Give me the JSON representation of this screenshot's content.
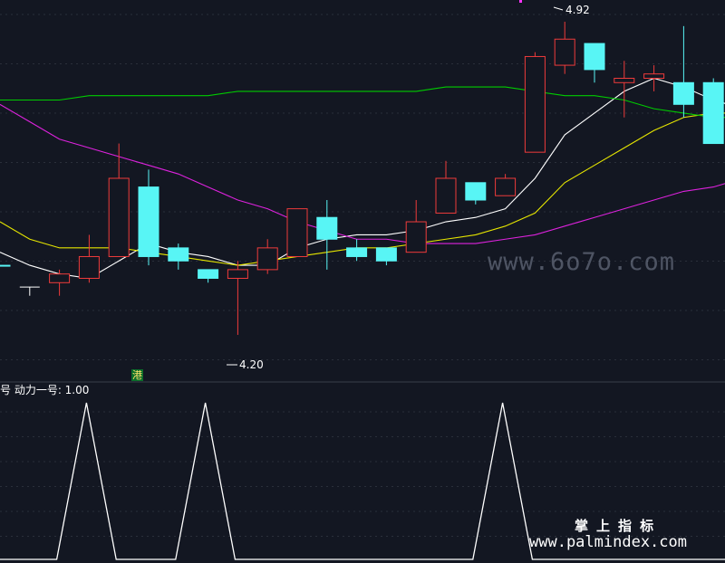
{
  "chart_data": {
    "type": "candlestick",
    "title": "",
    "indicator_label": "号 动力一号: 1.00",
    "annotations": {
      "high_label": "4.92",
      "low_label": "4.20",
      "tag": "港"
    },
    "watermarks": {
      "top": "www.6o7o.com",
      "bottom_cn": "掌 上 指 标",
      "bottom_url": "www.palmindex.com"
    },
    "ylim": [
      4.1,
      4.97
    ],
    "candles": [
      {
        "o": 4.36,
        "h": 4.36,
        "l": 4.36,
        "c": 4.36,
        "dir": "down",
        "partial": true
      },
      {
        "o": 4.31,
        "h": 4.31,
        "l": 4.29,
        "c": 4.31,
        "dir": "doji"
      },
      {
        "o": 4.32,
        "h": 4.35,
        "l": 4.29,
        "c": 4.34,
        "dir": "up"
      },
      {
        "o": 4.33,
        "h": 4.43,
        "l": 4.32,
        "c": 4.38,
        "dir": "up"
      },
      {
        "o": 4.38,
        "h": 4.64,
        "l": 4.38,
        "c": 4.56,
        "dir": "up"
      },
      {
        "o": 4.54,
        "h": 4.58,
        "l": 4.36,
        "c": 4.38,
        "dir": "down"
      },
      {
        "o": 4.4,
        "h": 4.41,
        "l": 4.35,
        "c": 4.37,
        "dir": "down"
      },
      {
        "o": 4.35,
        "h": 4.35,
        "l": 4.32,
        "c": 4.33,
        "dir": "down"
      },
      {
        "o": 4.33,
        "h": 4.37,
        "l": 4.2,
        "c": 4.35,
        "dir": "up"
      },
      {
        "o": 4.35,
        "h": 4.42,
        "l": 4.34,
        "c": 4.4,
        "dir": "up"
      },
      {
        "o": 4.38,
        "h": 4.49,
        "l": 4.38,
        "c": 4.49,
        "dir": "up"
      },
      {
        "o": 4.47,
        "h": 4.51,
        "l": 4.35,
        "c": 4.42,
        "dir": "down"
      },
      {
        "o": 4.4,
        "h": 4.42,
        "l": 4.37,
        "c": 4.38,
        "dir": "down"
      },
      {
        "o": 4.4,
        "h": 4.4,
        "l": 4.36,
        "c": 4.37,
        "dir": "down"
      },
      {
        "o": 4.39,
        "h": 4.51,
        "l": 4.39,
        "c": 4.46,
        "dir": "up"
      },
      {
        "o": 4.48,
        "h": 4.6,
        "l": 4.48,
        "c": 4.56,
        "dir": "up"
      },
      {
        "o": 4.55,
        "h": 4.55,
        "l": 4.5,
        "c": 4.51,
        "dir": "down"
      },
      {
        "o": 4.52,
        "h": 4.57,
        "l": 4.52,
        "c": 4.56,
        "dir": "up"
      },
      {
        "o": 4.62,
        "h": 4.85,
        "l": 4.62,
        "c": 4.84,
        "dir": "up"
      },
      {
        "o": 4.82,
        "h": 4.92,
        "l": 4.8,
        "c": 4.88,
        "dir": "up"
      },
      {
        "o": 4.87,
        "h": 4.87,
        "l": 4.78,
        "c": 4.81,
        "dir": "down"
      },
      {
        "o": 4.78,
        "h": 4.83,
        "l": 4.7,
        "c": 4.79,
        "dir": "up"
      },
      {
        "o": 4.79,
        "h": 4.82,
        "l": 4.76,
        "c": 4.8,
        "dir": "up"
      },
      {
        "o": 4.78,
        "h": 4.91,
        "l": 4.7,
        "c": 4.73,
        "dir": "down"
      },
      {
        "o": 4.78,
        "h": 4.79,
        "l": 4.64,
        "c": 4.64,
        "dir": "down"
      },
      {
        "o": 4.66,
        "h": 4.66,
        "l": 4.66,
        "c": 4.66,
        "dir": "doji",
        "partial": true
      }
    ],
    "ma_series": [
      {
        "color": "#ffffff",
        "values": [
          4.39,
          4.36,
          4.34,
          4.33,
          4.37,
          4.41,
          4.39,
          4.38,
          4.36,
          4.36,
          4.4,
          4.42,
          4.43,
          4.43,
          4.44,
          4.46,
          4.47,
          4.49,
          4.56,
          4.66,
          4.71,
          4.76,
          4.79,
          4.77,
          4.74,
          4.72
        ]
      },
      {
        "color": "#e6e600",
        "values": [
          4.46,
          4.42,
          4.4,
          4.4,
          4.4,
          4.39,
          4.38,
          4.37,
          4.36,
          4.37,
          4.38,
          4.39,
          4.4,
          4.4,
          4.41,
          4.42,
          4.43,
          4.45,
          4.48,
          4.55,
          4.59,
          4.63,
          4.67,
          4.7,
          4.71,
          4.71
        ]
      },
      {
        "color": "#00cc00",
        "values": [
          4.74,
          4.74,
          4.74,
          4.75,
          4.75,
          4.75,
          4.75,
          4.75,
          4.76,
          4.76,
          4.76,
          4.76,
          4.76,
          4.76,
          4.76,
          4.77,
          4.77,
          4.77,
          4.76,
          4.75,
          4.75,
          4.74,
          4.72,
          4.71,
          4.7,
          4.7
        ]
      },
      {
        "color": "#dd22dd",
        "values": [
          4.73,
          4.69,
          4.65,
          4.63,
          4.61,
          4.59,
          4.57,
          4.54,
          4.51,
          4.49,
          4.46,
          4.44,
          4.42,
          4.42,
          4.41,
          4.41,
          4.41,
          4.42,
          4.43,
          4.45,
          4.47,
          4.49,
          4.51,
          4.53,
          4.54,
          4.56
        ]
      }
    ],
    "indicator": {
      "values": [
        0,
        0,
        0,
        1,
        0,
        0,
        0,
        1,
        0,
        0,
        0,
        0,
        0,
        0,
        0,
        0,
        0,
        1,
        0,
        0,
        0,
        0,
        0,
        0,
        0,
        0
      ],
      "ylim": [
        0,
        1
      ]
    }
  }
}
